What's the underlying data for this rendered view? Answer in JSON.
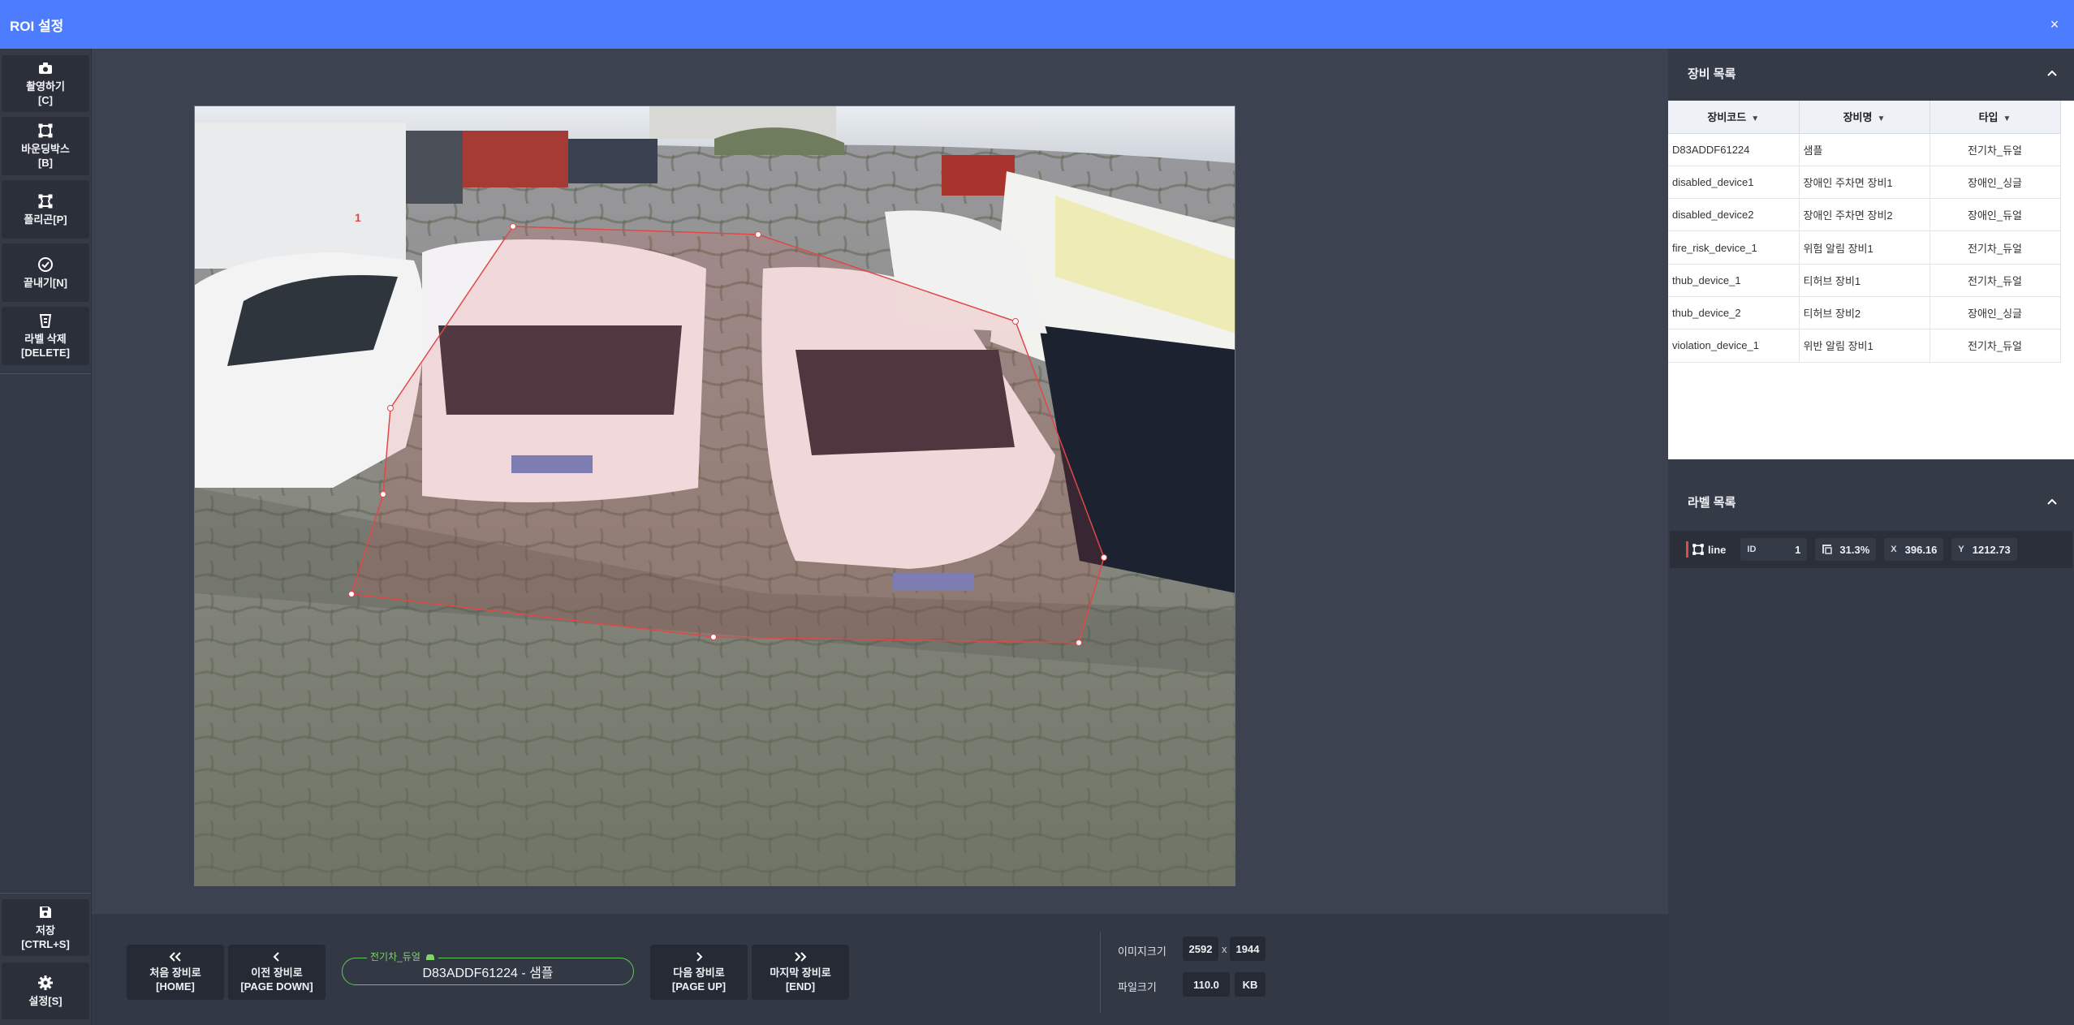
{
  "window": {
    "title": "ROI 설정",
    "close_glyph": "×"
  },
  "toolbar": {
    "items": [
      {
        "label": "촬영하기\n[C]",
        "icon": "camera-icon"
      },
      {
        "label": "바운딩박스\n[B]",
        "icon": "bounding-box-icon"
      },
      {
        "label": "폴리곤[P]",
        "icon": "polygon-icon"
      },
      {
        "label": "끝내기[N]",
        "icon": "check-circle-icon"
      },
      {
        "label": "라벨 삭제\n[DELETE]",
        "icon": "delete-label-icon"
      }
    ],
    "save_label": "저장\n[CTRL+S]",
    "settings_label": "설정[S]"
  },
  "navigation": {
    "first": "처음 장비로\n[HOME]",
    "prev": "이전 장비로\n[PAGE DOWN]",
    "next": "다음 장비로\n[PAGE UP]",
    "last": "마지막 장비로\n[END]",
    "device_type": "전기차_듀얼",
    "device_value": "D83ADDF61224 - 샘플"
  },
  "image_info": {
    "size_label": "이미지크기",
    "width": "2592",
    "x_sep": "x",
    "height": "1944",
    "file_label": "파일크기",
    "file_size": "110.0",
    "unit": "KB"
  },
  "device_list": {
    "title": "장비 목록",
    "columns": [
      "장비코드",
      "장비명",
      "타입"
    ],
    "rows": [
      [
        "D83ADDF61224",
        "샘플",
        "전기차_듀얼"
      ],
      [
        "disabled_device1",
        "장애인 주차면 장비1",
        "장애인_싱글"
      ],
      [
        "disabled_device2",
        "장애인 주차면 장비2",
        "장애인_듀얼"
      ],
      [
        "fire_risk_device_1",
        "위험 알림 장비1",
        "전기차_듀얼"
      ],
      [
        "thub_device_1",
        "티허브 장비1",
        "전기차_듀얼"
      ],
      [
        "thub_device_2",
        "티허브 장비2",
        "장애인_싱글"
      ],
      [
        "violation_device_1",
        "위반 알림 장비1",
        "전기차_듀얼"
      ]
    ]
  },
  "label_list": {
    "title": "라벨 목록",
    "item": {
      "type": "line",
      "id_label": "ID",
      "id": "1",
      "ratio": "31.3%",
      "x": "396.16",
      "y": "1212.73"
    }
  },
  "roi": {
    "label": "1",
    "color": "#e04848"
  },
  "colors": {
    "accent": "#4d7dfe",
    "sidebar": "#353a47",
    "device_outline": "#63c65a",
    "roi": "#e04848"
  }
}
